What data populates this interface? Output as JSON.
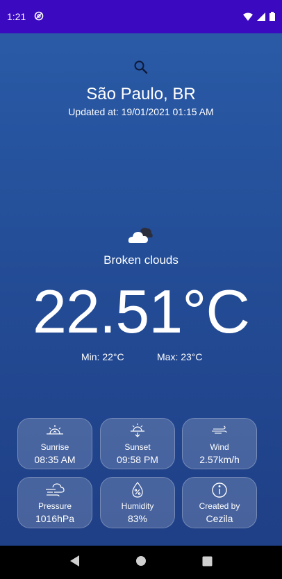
{
  "status_bar": {
    "time": "1:21",
    "icons": [
      "at-sign-icon",
      "wifi-icon",
      "signal-icon",
      "battery-icon"
    ]
  },
  "header": {
    "search_icon": "search-icon",
    "city": "São Paulo, BR",
    "updated": "Updated at: 19/01/2021 01:15 AM"
  },
  "weather": {
    "condition_icon": "broken-clouds-icon",
    "condition": "Broken clouds",
    "temperature": "22.51°C",
    "min": "Min: 22°C",
    "max": "Max: 23°C"
  },
  "details": [
    {
      "icon": "sunrise-icon",
      "label": "Sunrise",
      "value": "08:35 AM"
    },
    {
      "icon": "sunset-icon",
      "label": "Sunset",
      "value": "09:58 PM"
    },
    {
      "icon": "wind-icon",
      "label": "Wind",
      "value": "2.57km/h"
    },
    {
      "icon": "pressure-icon",
      "label": "Pressure",
      "value": "1016hPa"
    },
    {
      "icon": "humidity-icon",
      "label": "Humidity",
      "value": "83%"
    },
    {
      "icon": "info-icon",
      "label": "Created by",
      "value": "Cezila"
    }
  ],
  "nav_bar": {
    "icons": [
      "back-icon",
      "home-icon",
      "recents-icon"
    ]
  },
  "colors": {
    "status_bar": "#3a09c0",
    "background_top": "#2a5aa6",
    "background_bottom": "#1f3f86"
  }
}
